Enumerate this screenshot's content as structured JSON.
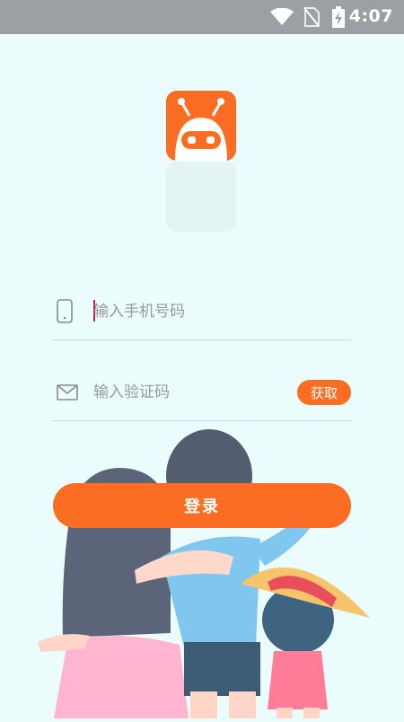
{
  "status_bar": {
    "time": "4:07",
    "icons": [
      "wifi-icon",
      "no-sim-icon",
      "battery-charging-icon"
    ]
  },
  "app": {
    "logo_icon": "robot-logo-icon",
    "brand_color": "#fb6d22",
    "background_color": "#eafcfb"
  },
  "login_form": {
    "phone_placeholder": "输入手机号码",
    "phone_value": "",
    "phone_icon": "phone-icon",
    "code_placeholder": "输入验证码",
    "code_value": "",
    "code_icon": "envelope-icon",
    "get_code_label": "获取",
    "login_label": "登录"
  },
  "illustration": "family-illustration"
}
